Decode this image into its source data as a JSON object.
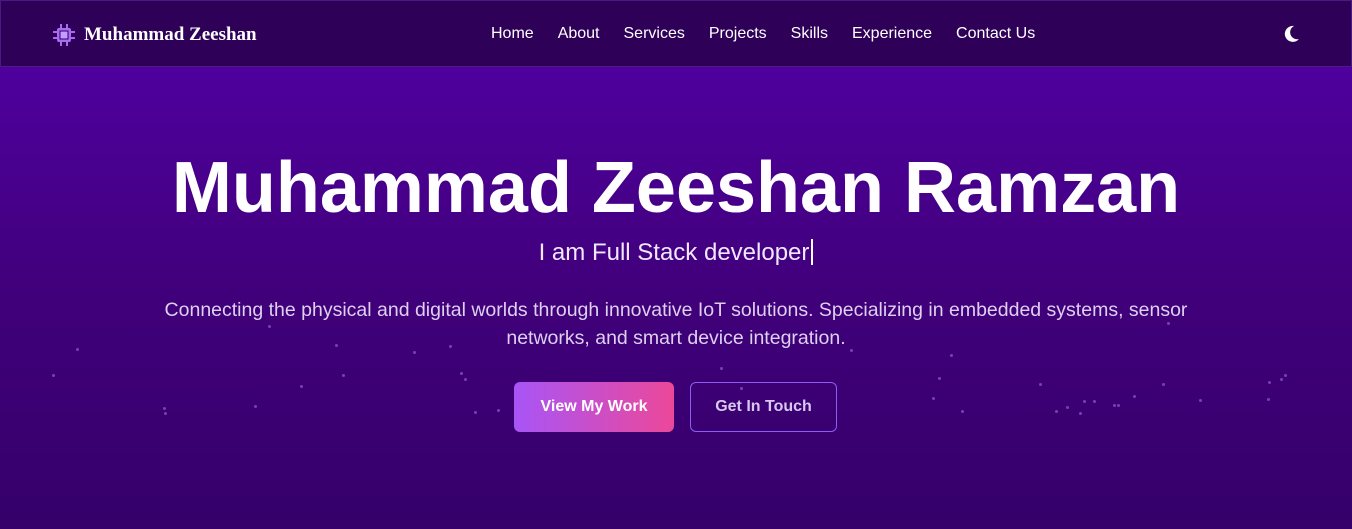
{
  "nav": {
    "brand": "Muhammad Zeeshan",
    "links": [
      "Home",
      "About",
      "Services",
      "Projects",
      "Skills",
      "Experience",
      "Contact Us"
    ]
  },
  "hero": {
    "title": "Muhammad Zeeshan Ramzan",
    "typing": "I am Full Stack developer",
    "description": "Connecting the physical and digital worlds through innovative IoT solutions. Specializing in embedded systems, sensor networks, and smart device integration.",
    "primary_button": "View My Work",
    "secondary_button": "Get In Touch"
  },
  "colors": {
    "accent_start": "#a855f7",
    "accent_end": "#ec4899",
    "nav_bg": "#2e0058"
  }
}
